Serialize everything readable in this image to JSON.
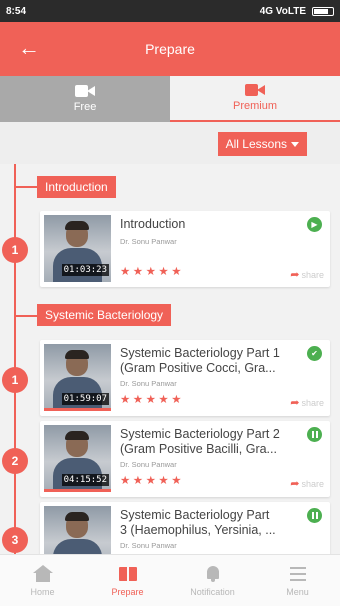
{
  "status_bar": {
    "time": "8:54",
    "right_text": "4G VoLTE"
  },
  "app_bar": {
    "back_icon": "back-arrow-icon",
    "title": "Prepare"
  },
  "tabs": [
    {
      "label": "Free",
      "icon": "video-camera-icon",
      "selected": false
    },
    {
      "label": "Premium",
      "icon": "video-camera-icon",
      "selected": true
    }
  ],
  "filter": {
    "selected": "All Lessons",
    "icon": "dropdown-caret-icon"
  },
  "sections": [
    {
      "title": "Introduction",
      "lessons": [
        {
          "number": "1",
          "title": "Introduction",
          "author": "Dr. Sonu Panwar",
          "duration": "01:03:23",
          "stars": "★★★★★",
          "share": "share",
          "status": "play-icon"
        }
      ]
    },
    {
      "title": "Systemic Bacteriology",
      "lessons": [
        {
          "number": "1",
          "title": "Systemic Bacteriology Part 1\n(Gram Positive Cocci, Gra...",
          "author": "Dr. Sonu Panwar",
          "duration": "01:59:07",
          "stars": "★★★★★",
          "share": "share",
          "status": "check-icon"
        },
        {
          "number": "2",
          "title": "Systemic Bacteriology Part 2\n(Gram Positive Bacilli, Gra...",
          "author": "Dr. Sonu Panwar",
          "duration": "04:15:52",
          "stars": "★★★★★",
          "share": "share",
          "status": "pause-icon"
        },
        {
          "number": "3",
          "title": "Systemic Bacteriology Part\n3 (Haemophilus, Yersinia, ...",
          "author": "Dr. Sonu Panwar",
          "duration": "",
          "stars": "",
          "share": "",
          "status": "pause-icon"
        }
      ]
    }
  ],
  "bottom_nav": [
    {
      "label": "Home",
      "icon": "home-icon",
      "active": false
    },
    {
      "label": "Prepare",
      "icon": "book-icon",
      "active": true
    },
    {
      "label": "Notification",
      "icon": "bell-icon",
      "active": false
    },
    {
      "label": "Menu",
      "icon": "hamburger-menu-icon",
      "active": false
    }
  ],
  "colors": {
    "accent": "#f06157",
    "success": "#4caf50",
    "tab_inactive": "#a9a9a9"
  }
}
